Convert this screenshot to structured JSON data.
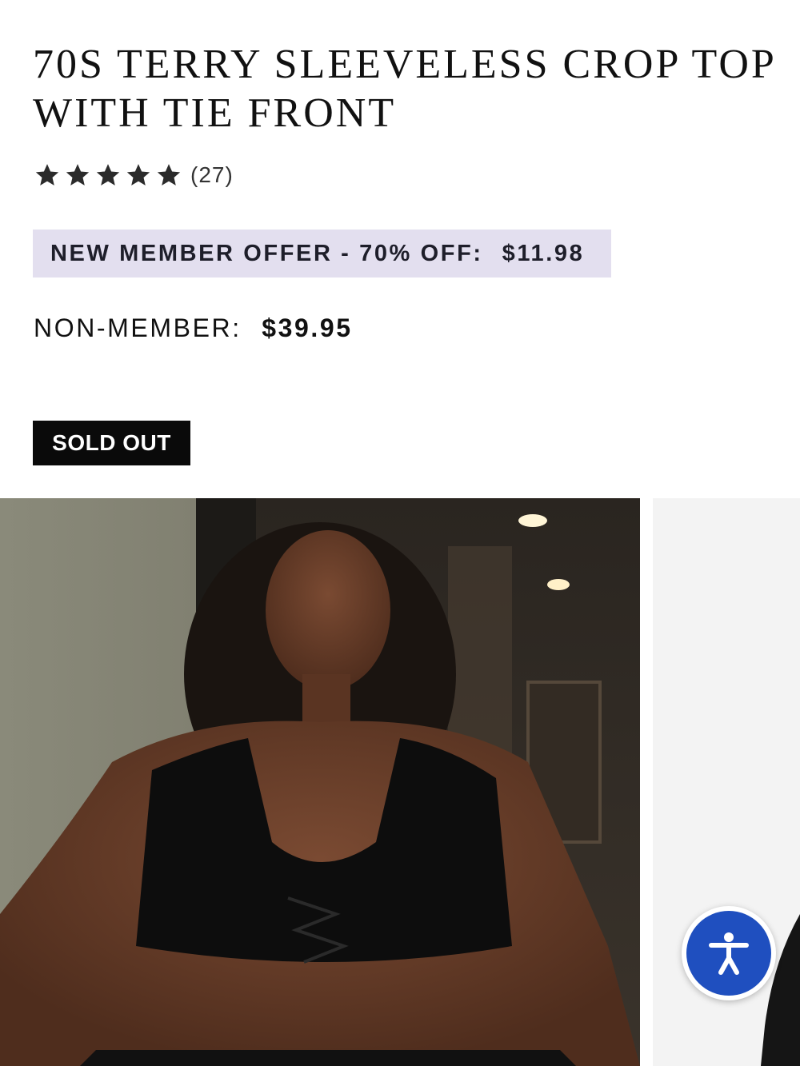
{
  "product": {
    "title": "70S TERRY SLEEVELESS CROP TOP WITH TIE FRONT",
    "rating": {
      "stars": 5,
      "review_count": "(27)"
    },
    "member_offer": {
      "label": "NEW MEMBER OFFER - 70% OFF:",
      "price": "$11.98"
    },
    "non_member": {
      "label": "NON-MEMBER:",
      "price": "$39.95"
    },
    "status_button": "SOLD OUT"
  },
  "gallery": {
    "images": [
      {
        "semantic": "model-photo",
        "description_icon": "image"
      },
      {
        "semantic": "product-photo",
        "description_icon": "image"
      }
    ]
  },
  "accessibility": {
    "icon": "accessibility-icon"
  },
  "colors": {
    "offer_bg": "#e3dfef",
    "sold_out_bg": "#0a0a0a",
    "a11y_blue": "#1f4fbf"
  }
}
